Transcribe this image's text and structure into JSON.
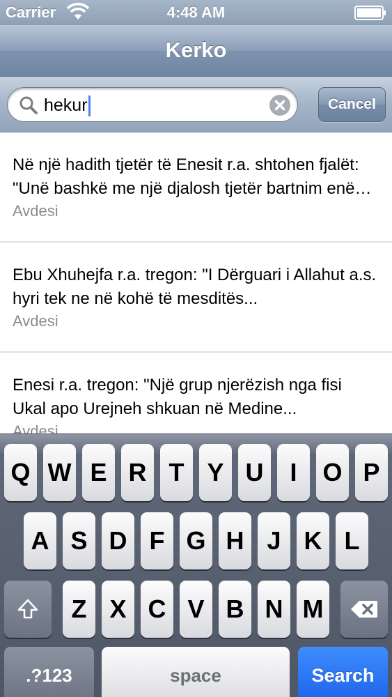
{
  "status_bar": {
    "carrier": "Carrier",
    "time": "4:48 AM"
  },
  "nav": {
    "title": "Kerko"
  },
  "search": {
    "value": "hekur",
    "cancel_label": "Cancel"
  },
  "results": [
    {
      "text": "Në një hadith tjetër të Enesit r.a. shtohen fjalët: \"Unë bashkë me një djalosh tjetër bartnim enën me ujë...",
      "category": "Avdesi"
    },
    {
      "text": "Ebu Xhuhejfa r.a. tregon: \"I Dërguari i Allahut a.s. hyri tek ne në kohë të mesditës...",
      "category": "Avdesi"
    },
    {
      "text": "Enesi r.a. tregon: \"Një grup njerëzish nga fisi Ukal apo Urejneh shkuan në Medine...",
      "category": "Avdesi"
    }
  ],
  "keyboard": {
    "row1": [
      "Q",
      "W",
      "E",
      "R",
      "T",
      "Y",
      "U",
      "I",
      "O",
      "P"
    ],
    "row2": [
      "A",
      "S",
      "D",
      "F",
      "G",
      "H",
      "J",
      "K",
      "L"
    ],
    "row3": [
      "Z",
      "X",
      "C",
      "V",
      "B",
      "N",
      "M"
    ],
    "numbers_label": ".?123",
    "space_label": "space",
    "search_label": "Search"
  },
  "colors": {
    "search_key": "#1c62e9",
    "caret": "#4a86e8",
    "nav": "#8b9fb8"
  }
}
